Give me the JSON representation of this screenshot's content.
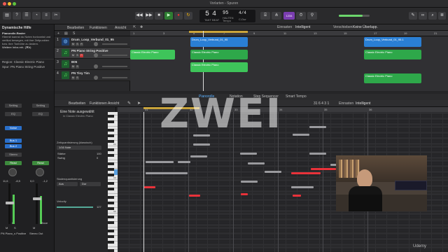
{
  "window": {
    "title": "Vorlarten - Spuren"
  },
  "transport": {
    "bar": "5",
    "beat": "4",
    "tempo": "95",
    "tempo_label": "Tempo",
    "key": "C-Dur",
    "signature": "4/4",
    "mode_badge": "1234",
    "pos_label": "TAKT",
    "beat_label": "BEAT",
    "keep_label": "HALTEN"
  },
  "library": {
    "header": "Dynamische Hilfe",
    "subheader": "Pianorolle-Raster",
    "text": "Hiermit kannst du Noten horizontal und vertikal bewegen, mit ihre Zeitpunkten bzw. ihre Tonhöhe zu ändern.",
    "more": "Weitere Infos erh. (⌘#)",
    "region_label": "Region: Classic Electric Piano",
    "track_label": "Spur: PN Piano String Positive"
  },
  "track_menu": {
    "edit": "Bearbeiten",
    "functions": "Funktionen",
    "view": "Ansicht"
  },
  "tracks": [
    {
      "num": "1",
      "name": "Drum_Loop_Verbund_01_95"
    },
    {
      "num": "2",
      "name": "PN Piano String Positive"
    },
    {
      "num": "3",
      "name": "B05"
    },
    {
      "num": "4",
      "name": "PN Tiny Tim"
    }
  ],
  "arrange_tools": {
    "snap": "Einrasten",
    "snap_value": "Intelligent",
    "drag": "Verschieben",
    "drag_value": "Keine Überlapp."
  },
  "ruler": [
    "1",
    "3",
    "5",
    "7",
    "9",
    "11",
    "13",
    "15",
    "17",
    "19",
    "21"
  ],
  "regions": {
    "drum_a": "Drum_Loop_Verbund_01_95",
    "drum_b": "Drum_Loop_Verbund_01_95.1",
    "ep_a": "Classic Electric Piano",
    "ep_b": "Classic Electric Piano",
    "ep_c": "Classic Electric Piano",
    "ep_d": "Classic Electric Piano",
    "ep_e": "Classic Electric Piano"
  },
  "piano_roll": {
    "tabs": [
      "Pianorolle",
      "Notation",
      "Step Sequencer",
      "Smart Tempo"
    ],
    "edit": "Bearbeiten",
    "functions": "Funktionen",
    "view": "Ansicht",
    "position": "31  6 4 3 1",
    "snap": "Einrasten",
    "snap_value": "Intelligent",
    "no_note": "Eine Note ausgewählt",
    "in_region": "in Classic Electric Piano",
    "region_name": "Classic Electric Piano",
    "quant_label": "Zeitquantisierung (klassisch)",
    "quant_value": "1/16 Note",
    "strength": "Stärke",
    "strength_val": "100",
    "swing": "Swing",
    "swing_val": "0",
    "scale_label": "Skalenquantisierung",
    "scale_a": "Aus",
    "scale_b": "Dur",
    "velocity": "Velocity",
    "velocity_val": "127",
    "keys": [
      "C4",
      "C3",
      "C2"
    ],
    "ruler": [
      "31",
      "32",
      "33",
      "34",
      "35",
      "36"
    ]
  },
  "mixer": {
    "strips": [
      {
        "name": "PN Piano_s Positive",
        "setting": "Setting",
        "eq": "EQ",
        "slot": "Noise",
        "bus": "Bus 1",
        "bus2": "Bus 2",
        "out": "Stereo",
        "read": "Read",
        "val": "11,6",
        "val2": "-8,5",
        "m": "M",
        "s": "S",
        "pan": "I"
      },
      {
        "name": "Stereo Out",
        "setting": "Setting",
        "eq": "EQ",
        "slot": "",
        "bus": "",
        "bus2": "",
        "out": "",
        "read": "Read",
        "val": "0,0",
        "val2": "-1,2",
        "m": "M",
        "s": "",
        "pan": "Bnce"
      }
    ]
  },
  "overlay": {
    "text": "ZWEI"
  },
  "watermark": "Udemy"
}
